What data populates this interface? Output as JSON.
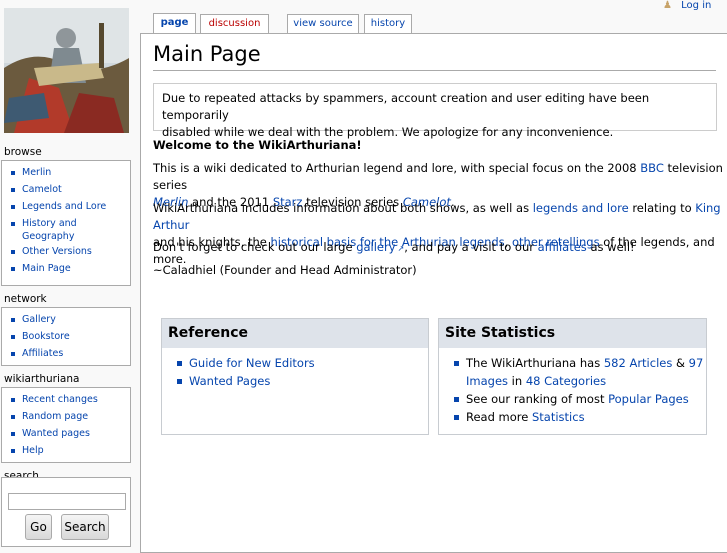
{
  "personal": {
    "login": "Log in"
  },
  "tabs": [
    {
      "label": "page"
    },
    {
      "label": "discussion"
    },
    {
      "label": "view source"
    },
    {
      "label": "history"
    }
  ],
  "sidebar": {
    "browse": {
      "title": "browse",
      "items": [
        "Merlin",
        "Camelot",
        "Legends and Lore",
        "History and",
        "Geography",
        "Other Versions",
        "Main Page"
      ]
    },
    "network": {
      "title": "network",
      "items": [
        "Gallery",
        "Bookstore",
        "Affiliates"
      ]
    },
    "wiki": {
      "title": "wikiarthuriana",
      "items": [
        "Recent changes",
        "Random page",
        "Wanted pages",
        "Help"
      ]
    },
    "search": {
      "title": "search",
      "go": "Go",
      "search": "Search"
    }
  },
  "main": {
    "title": "Main Page",
    "notice_line1": "Due to repeated attacks by spammers, account creation and user editing have been temporarily",
    "notice_line2": "disabled while we deal with the problem. We apologize for any inconvenience.",
    "welcome": "Welcome to the WikiArthuriana!",
    "p1": {
      "a": "This is a wiki dedicated to Arthurian legend and lore, with special focus on the 2008 ",
      "bbc": "BBC",
      "b": " television series",
      "merlin": "Merlin",
      "c": " and the 2011 ",
      "starz": "Starz",
      "d": " television series ",
      "camelot": "Camelot",
      "e": "."
    },
    "p2": {
      "a": "WikiArthuriana includes information about both shows, as well as ",
      "legends": "legends and lore",
      "b": " relating to ",
      "king": "King Arthur",
      "c": "and his knights, the ",
      "historical": "historical basis for the Arthurian legends",
      "d": ", ",
      "retellings": "other retellings",
      "e": " of the legends, and more."
    },
    "p3": {
      "a": "Don't forget to check out our large ",
      "gallery": "gallery",
      "b": ", and pay a visit to our ",
      "affiliates": "affiliates",
      "c": " as well!"
    },
    "signature": "~Caladhiel (Founder and Head Administrator)"
  },
  "reference": {
    "title": "Reference",
    "items": [
      "Guide for New Editors",
      "Wanted Pages"
    ]
  },
  "stats": {
    "title": "Site Statistics",
    "line1a": "The WikiArthuriana has ",
    "articles": "582 Articles",
    "amp": " & ",
    "n97": "97",
    "images": "Images",
    "in": " in ",
    "categories": "48 Categories",
    "line2a": "See our ranking of most ",
    "popular": "Popular Pages",
    "line3a": "Read more ",
    "statistics": "Statistics"
  }
}
